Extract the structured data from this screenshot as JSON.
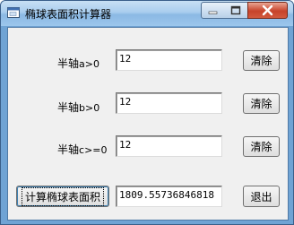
{
  "window": {
    "title": "椭球表面积计算器",
    "icon": "app-window-icon",
    "controls": [
      "minimize-icon",
      "maximize-icon",
      "close-icon"
    ]
  },
  "form": {
    "rows": [
      {
        "label_main": "半轴",
        "label_sub": "a>0",
        "value": "12",
        "button": "清除"
      },
      {
        "label_main": "半轴",
        "label_sub": "b>0",
        "value": "12",
        "button": "清除"
      },
      {
        "label_main": "半轴",
        "label_sub": "c>=0",
        "value": "12",
        "button": "清除"
      }
    ],
    "compute_button": "计算椭球表面积",
    "result": "1809.55736846818",
    "exit_button": "退出"
  },
  "colors": {
    "titlebar": "#a9cdee",
    "close_button": "#c7432a",
    "client_bg": "#f0f0f0"
  }
}
